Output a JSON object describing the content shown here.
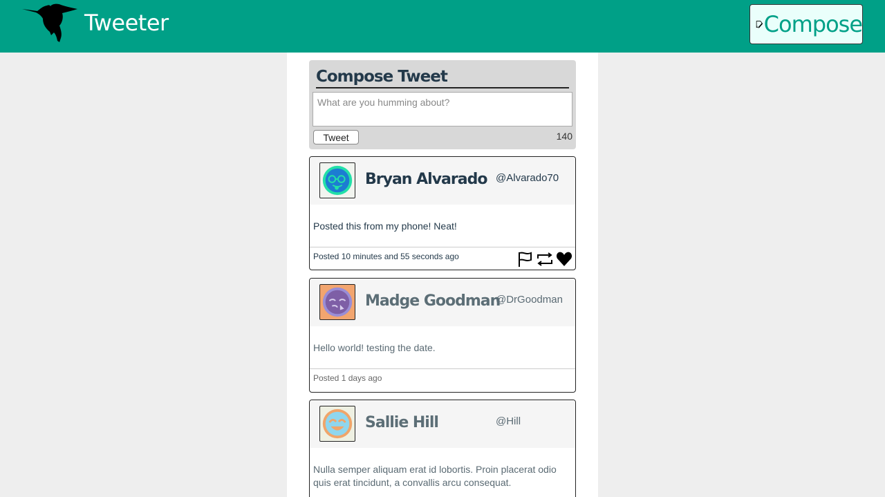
{
  "header": {
    "brand": "Tweeter",
    "compose_label": "Compose",
    "colors": {
      "bar": "#00a087",
      "compose_bg": "#eafffb"
    }
  },
  "composer": {
    "title": "Compose Tweet",
    "placeholder": "What are you humming about?",
    "tweet_button": "Tweet",
    "counter": "140"
  },
  "tweets": [
    {
      "name": "Bryan Alvarado",
      "handle": "@Alvarado70",
      "text": "Posted this from my phone! Neat!",
      "posted": "Posted 10 minutes and 55 seconds ago",
      "avatar_icon": "nerd-face-avatar-icon",
      "actions": [
        "flag-icon",
        "retweet-icon",
        "heart-icon"
      ]
    },
    {
      "name": "Madge Goodman",
      "handle": "@DrGoodman",
      "text": "Hello world! testing the date.",
      "posted": "Posted 1 days ago",
      "avatar_icon": "sleepy-face-avatar-icon"
    },
    {
      "name": "Sallie Hill",
      "handle": "@Hill",
      "text": "Nulla semper aliquam erat id lobortis. Proin placerat odio quis erat tincidunt, a convallis arcu consequat.",
      "avatar_icon": "laughing-face-avatar-icon"
    }
  ]
}
